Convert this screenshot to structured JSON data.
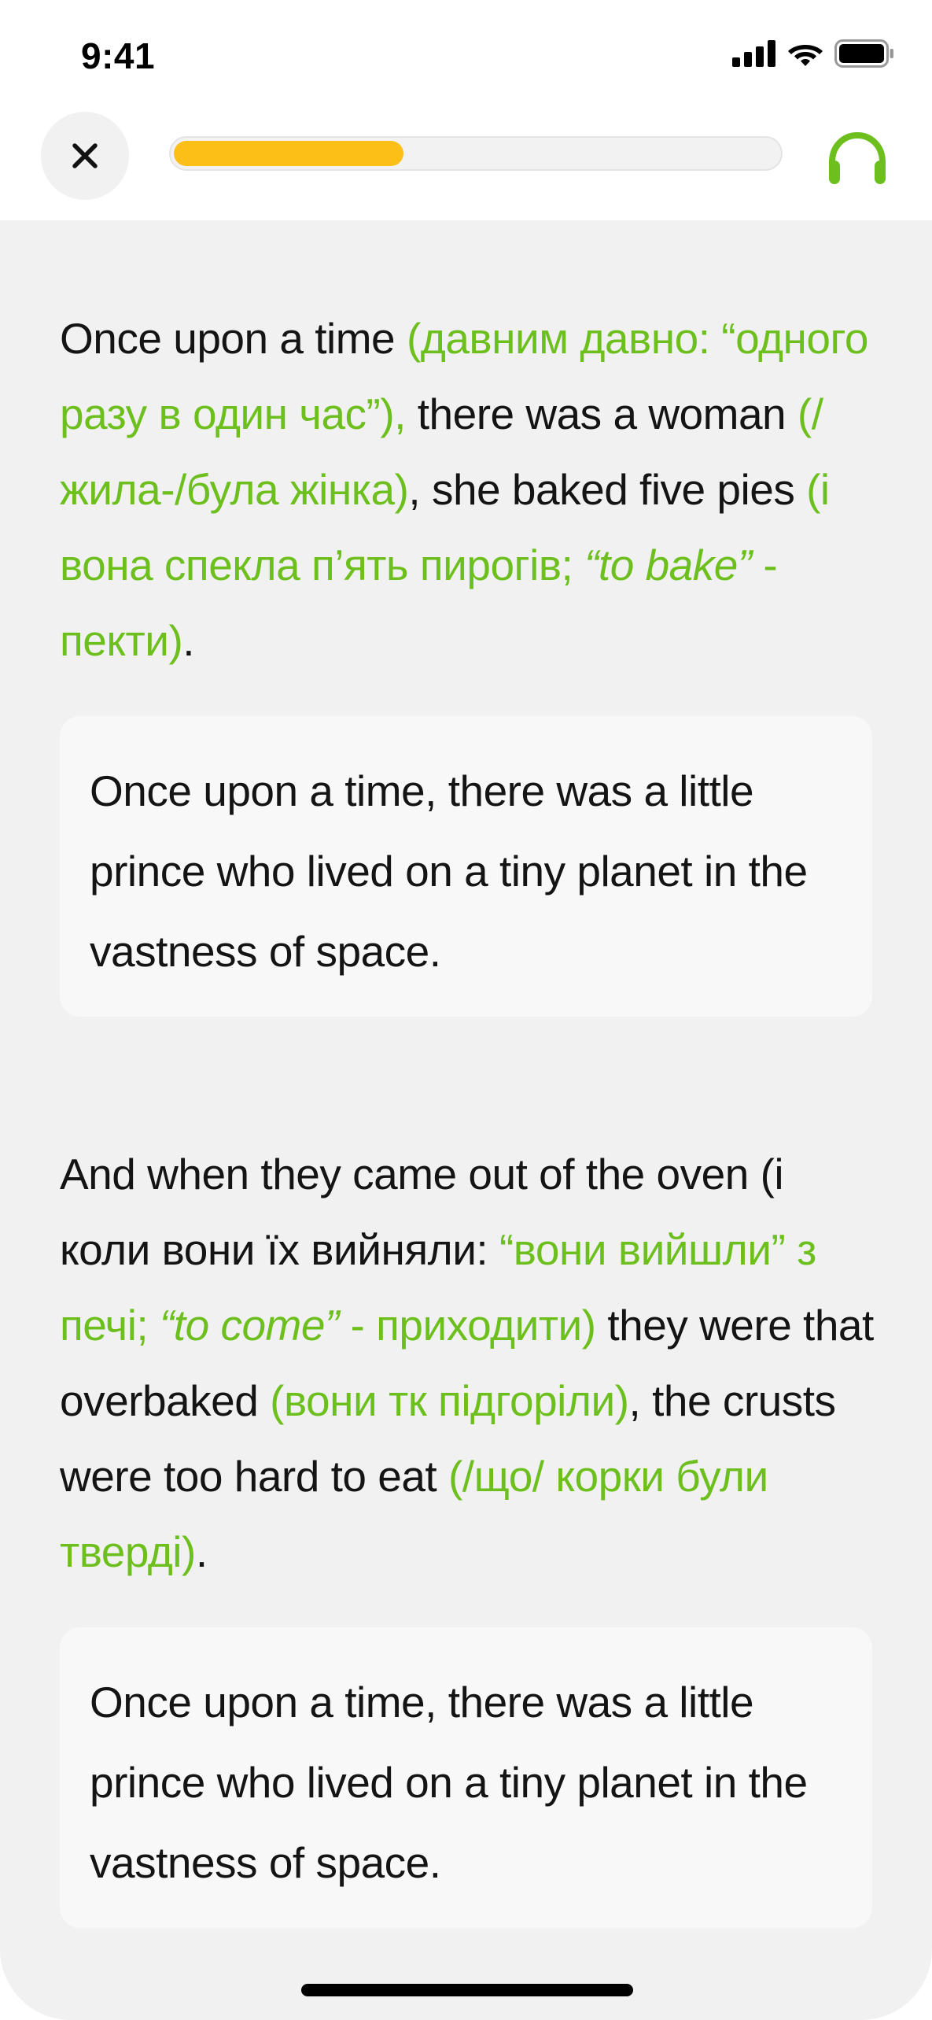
{
  "status_bar": {
    "time": "9:41"
  },
  "header": {
    "close_icon": "close-icon",
    "progress": 0.38,
    "progress_color": "#fbbf17",
    "audio_icon": "headphones-icon",
    "accent_color": "#6cbf1d"
  },
  "paragraphs": [
    {
      "segments": {
        "s1": "Once upon a time ",
        "t1": "(давним давно: “одного разу в один час”),",
        "s2": " there was a woman ",
        "t2": "(/жила-/була жінка)",
        "s3": ", she baked five pies ",
        "t3a": "(і вона спекла п’ять пирогів; ",
        "t3i": "“to bake”",
        "t3b": " - пекти)",
        "s4": "."
      },
      "card_text": "Once upon a time, there was a little prince who lived on a tiny planet in the vastness of space."
    },
    {
      "segments": {
        "s1": "And when they came out of the oven (і коли вони їх вийняли: ",
        "t1a": "“вони вийшли” з печі; ",
        "t1i": "“to come”",
        "t1b": " - приходити)",
        "s2": " they were that overbaked ",
        "t2": "(вони тк підгоріли)",
        "s3": ", the crusts were too hard to eat ",
        "t3": "(/що/ корки були тверді)",
        "s4": "."
      },
      "card_text": "Once upon a time, there was a little prince who lived on a tiny planet in the vastness of space."
    }
  ]
}
